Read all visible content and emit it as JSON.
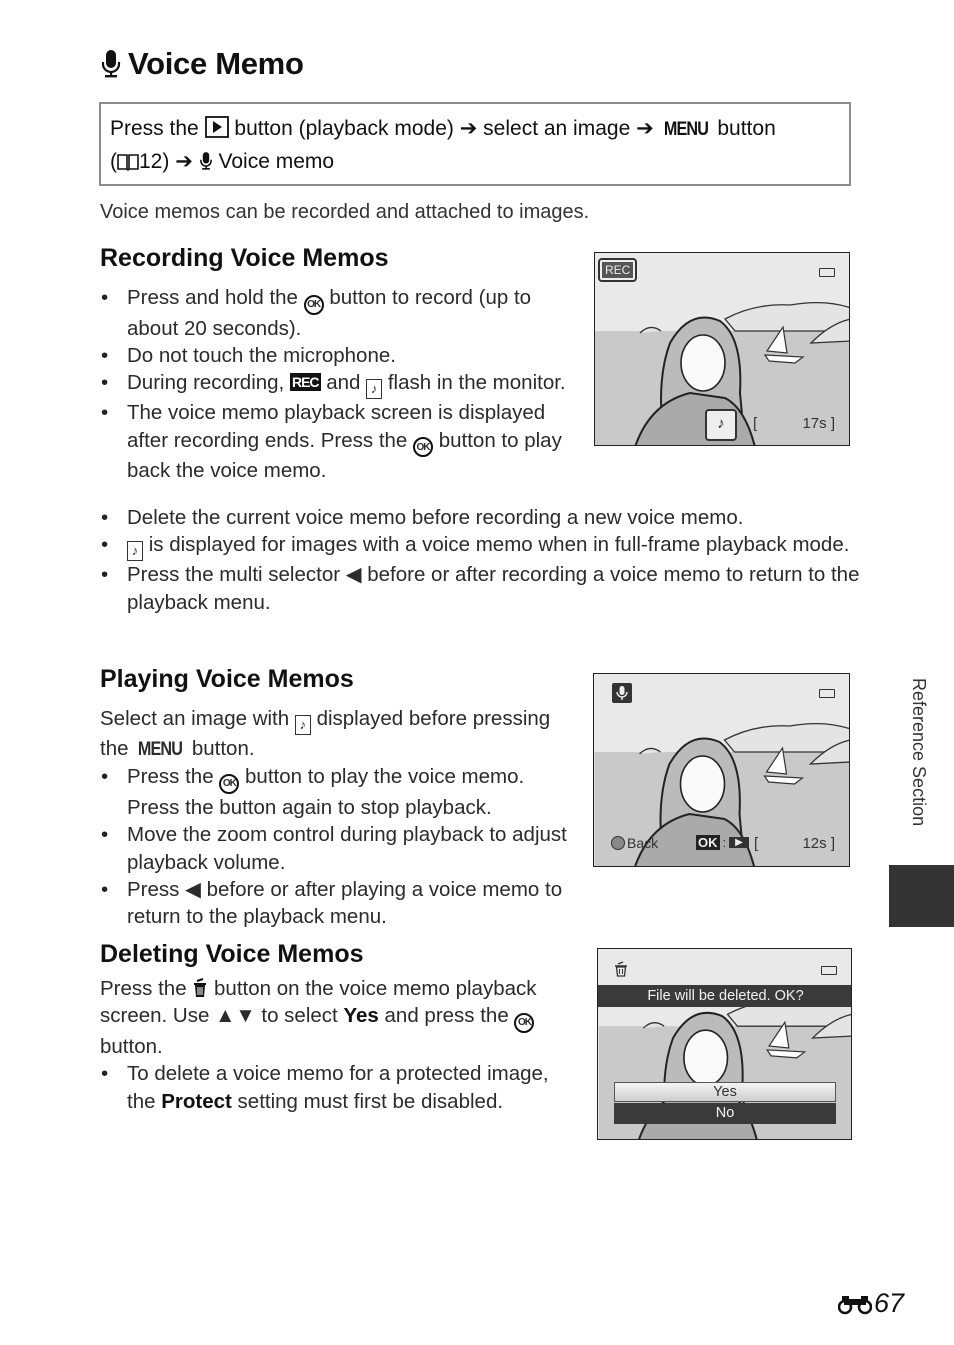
{
  "page": {
    "title": "Voice Memo",
    "title_icon": "microphone-icon",
    "nav_path": {
      "part1": "Press the",
      "playback_icon": "playback-button-icon",
      "part2": "button (playback mode)",
      "arrow": "➔",
      "part3": "select an image",
      "menu_label": "MENU",
      "part4": "button",
      "ref_open": "(",
      "book_icon": "book-icon",
      "ref_page": "12)",
      "mic_icon": "microphone-icon",
      "part5": "Voice memo"
    },
    "intro": "Voice memos can be recorded and attached to images.",
    "side_label": "Reference Section",
    "page_prefix_icon": "binoculars-icon",
    "page_number": "67"
  },
  "recording": {
    "heading": "Recording Voice Memos",
    "bullets": [
      {
        "a": "Press and hold the",
        "icon": "ok-button-icon",
        "b": "button to record (up to about 20 seconds)."
      },
      {
        "a": "Do not touch the microphone."
      },
      {
        "a": "During recording,",
        "icon": "rec-icon",
        "icon_text": "REC",
        "b": "and",
        "icon2": "voice-memo-icon",
        "c": "flash in the monitor."
      },
      {
        "a": "The voice memo playback screen is displayed after recording ends. Press the",
        "icon": "ok-button-icon",
        "b": "button to play back the voice memo."
      },
      {
        "a": "Delete the current voice memo before recording a new voice memo."
      },
      {
        "icon": "voice-memo-icon",
        "a": "is displayed for images with a voice memo when in full-frame playback mode."
      },
      {
        "a": "Press the multi selector",
        "icon": "left-arrow-icon",
        "b": "before or after recording a voice memo to return to the playback menu."
      }
    ],
    "screen": {
      "rec_label": "REC",
      "battery_icon": "battery-icon",
      "memo_icon": "voice-memo-icon",
      "time": "17s"
    }
  },
  "playing": {
    "heading": "Playing Voice Memos",
    "intro_a": "Select an image with",
    "intro_icon": "voice-memo-icon",
    "intro_b": "displayed before pressing the",
    "intro_menu": "MENU",
    "intro_c": "button.",
    "bullets": [
      {
        "a": "Press the",
        "icon": "ok-button-icon",
        "b": "button to play the voice memo. Press the button again to stop playback."
      },
      {
        "a": "Move the zoom control during playback to adjust playback volume."
      },
      {
        "a": "Press",
        "icon": "left-arrow-icon",
        "b": "before or after playing a voice memo to return to the playback menu."
      }
    ],
    "screen": {
      "mic_icon": "microphone-icon",
      "battery_icon": "battery-icon",
      "back_label": "Back",
      "ok_label": "OK",
      "time": "12s"
    }
  },
  "deleting": {
    "heading": "Deleting Voice Memos",
    "intro_a": "Press the",
    "intro_icon": "trash-icon",
    "intro_b": "button on the voice memo playback screen. Use",
    "intro_arrows": "▲▼",
    "intro_c": "to select",
    "intro_bold": "Yes",
    "intro_d": "and press the",
    "intro_ok": "ok-button-icon",
    "intro_e": "button.",
    "bullets": [
      {
        "a": "To delete a voice memo for a protected image, the",
        "bold": "Protect",
        "b": "setting must first be disabled."
      }
    ],
    "screen": {
      "trash_icon": "trash-icon",
      "battery_icon": "battery-icon",
      "prompt": "File will be deleted. OK?",
      "options": [
        {
          "label": "Yes",
          "selected": true
        },
        {
          "label": "No",
          "selected": false
        }
      ]
    }
  },
  "colors": {
    "tab": "#333333",
    "box_border": "#8c8c8c",
    "screen_bg": "#e9e9e9",
    "dialog_bar": "#3a3a3a"
  }
}
